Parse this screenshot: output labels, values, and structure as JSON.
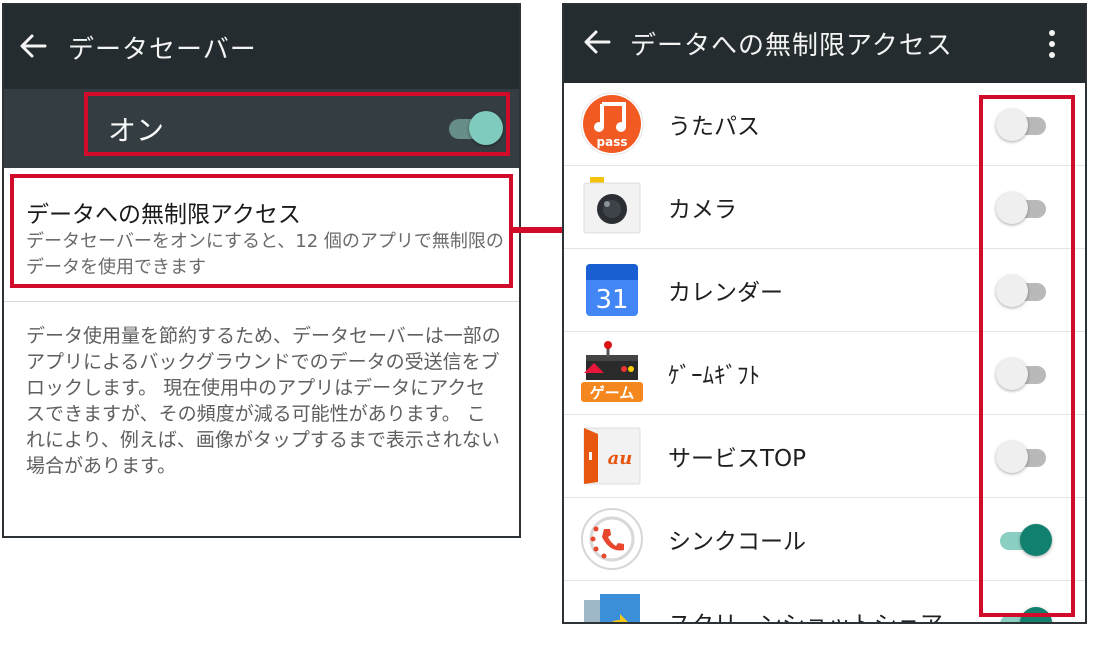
{
  "left": {
    "title": "データセーバー",
    "master": {
      "label": "オン",
      "state": "on"
    },
    "unrestricted_item": {
      "title": "データへの無制限アクセス",
      "description": "データセーバーをオンにすると、12 個のアプリで無制限のデータを使用できます"
    },
    "footer_text": "データ使用量を節約するため、データセーバーは一部のアプリによるバックグラウンドでのデータの受送信をブロックします。 現在使用中のアプリはデータにアクセスできますが、その頻度が減る可能性があります。 これにより、例えば、画像がタップするまで表示されない場合があります。"
  },
  "right": {
    "title": "データへの無制限アクセス",
    "apps": [
      {
        "name": "うたパス",
        "icon": "utapass-icon",
        "enabled": false,
        "icon_text": "pass"
      },
      {
        "name": "カメラ",
        "icon": "camera-icon",
        "enabled": false
      },
      {
        "name": "カレンダー",
        "icon": "calendar-icon",
        "enabled": false,
        "icon_text": "31"
      },
      {
        "name": "ｹﾞｰﾑｷﾞﾌﾄ",
        "icon": "game-gift-icon",
        "enabled": false,
        "icon_text": "ゲーム"
      },
      {
        "name": "サービスTOP",
        "icon": "au-service-icon",
        "enabled": false,
        "icon_text": "au"
      },
      {
        "name": "シンクコール",
        "icon": "synccall-icon",
        "enabled": true
      },
      {
        "name": "スクリーンショットシェア",
        "icon": "screenshot-share-icon",
        "enabled": true
      }
    ]
  },
  "colors": {
    "toolbar": "#252c2f",
    "highlight": "#d30b2b",
    "toggle_on": "#12806e",
    "master_toggle": "#7fcbbd"
  }
}
